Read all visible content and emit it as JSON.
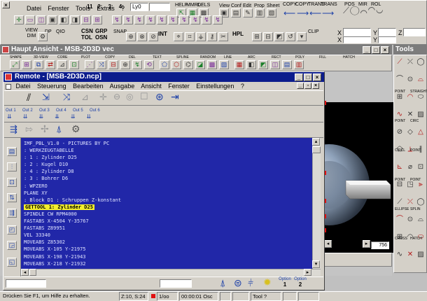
{
  "top_menu": [
    "Datei",
    "Fenster",
    "Tools",
    "Extras",
    "?"
  ],
  "views": [
    "11",
    "2:",
    "3:",
    "4:"
  ],
  "layer_field": "Ly0",
  "top_row_labels": [
    "HELP",
    "MMRL",
    "DELS",
    "View",
    "Conf",
    "Edit",
    "Prop",
    "Sheet",
    "COPY",
    "COPY",
    "TRANS",
    "TRANS",
    "POS",
    "MIR",
    "ROL"
  ],
  "xyz_labels": [
    "X",
    "Y",
    "Z",
    "X",
    "Y",
    "Z",
    "X"
  ],
  "row2_text_labels": [
    "VIEW",
    "DIM",
    "DP",
    "QIO",
    "CSN",
    "GRP",
    "TOL",
    "OSN",
    "SNAP",
    "INT",
    "HPL",
    "CLIP"
  ],
  "haupt_title": "Haupt Ansicht  -  MSB-2D3D vec",
  "haupt_toolbar_labels": [
    "SHAPE",
    "3D-VIEW",
    "CORE",
    "PLOT",
    "COPY",
    "DEL",
    "TEXT",
    "SPLINE",
    "RANDOM",
    "LINE",
    "ARC",
    "RECT",
    "POLY",
    "FILL",
    "HATCH"
  ],
  "remote_title": "Remote - [MSB-2D3D.ncp]",
  "remote_menu": [
    {
      "label": "Datei",
      "key": "D"
    },
    {
      "label": "Steuerung",
      "key": "S"
    },
    {
      "label": "Bearbeiten",
      "key": "B"
    },
    {
      "label": "Ausgabe",
      "key": "A"
    },
    {
      "label": "Ansicht",
      "key": "A"
    },
    {
      "label": "Fenster",
      "key": "F"
    },
    {
      "label": "Einstellungen",
      "key": "E"
    },
    {
      "label": "?",
      "key": "?"
    }
  ],
  "remote_tb2_labels": [
    "Out 1",
    "Out 2",
    "Out 3",
    "Out 4",
    "Out 5",
    "Out 6"
  ],
  "code_lines": [
    "IMF_PBL_V1.0 - PICTURES BY PC",
    ": WERKZEUGTABELLE",
    ": 1 : Zylinder D25",
    ": 2 : Kugel D10",
    ": 4 : Zylinder D8",
    ": 3 : Bohrer D6",
    ": WPZERO",
    "PLANE XY",
    ": Block D1 : Schruppen Z-konstant",
    "GETTOOL 1: Zylinder D25",
    "SPINDLE CW RPM4000",
    "FASTABS X-4504 Y-35767",
    "FASTABS Z89951",
    "VEL 33340",
    "MOVEABS Z85302",
    "MOVEABS X-105 Y-21975",
    "MOVEABS X-198 Y-21943",
    "MOVEABS X-218 Y-21932",
    "MOVEABS X-307 Y-21973"
  ],
  "highlighted_line_index": 9,
  "option_buttons": [
    {
      "label": "Option",
      "num": "1"
    },
    {
      "label": "Option",
      "num": "2"
    }
  ],
  "graphic_field_value": "756",
  "tools_title": "Tools",
  "right_palette_labels": [
    "POINT",
    "STRAIGHT",
    "POINT",
    "CIRC",
    "CIRCL",
    "POINT",
    "POINT",
    "POINT",
    "ELLIPSE",
    "SPLIN",
    "CROSS",
    "HATCH"
  ],
  "status": {
    "help": "Drücken Sie F1, um Hilfe zu erhalten.",
    "coords": "Z:10, S:24",
    "scale": "1/oo",
    "time": "00:00:01 Osc",
    "tool": "Tool ?"
  },
  "colors": {
    "title_active": "#0c1c8c",
    "title_inactive": "#808080",
    "editor_bg": "#2127a8",
    "highlight": "#f4ef2c"
  }
}
